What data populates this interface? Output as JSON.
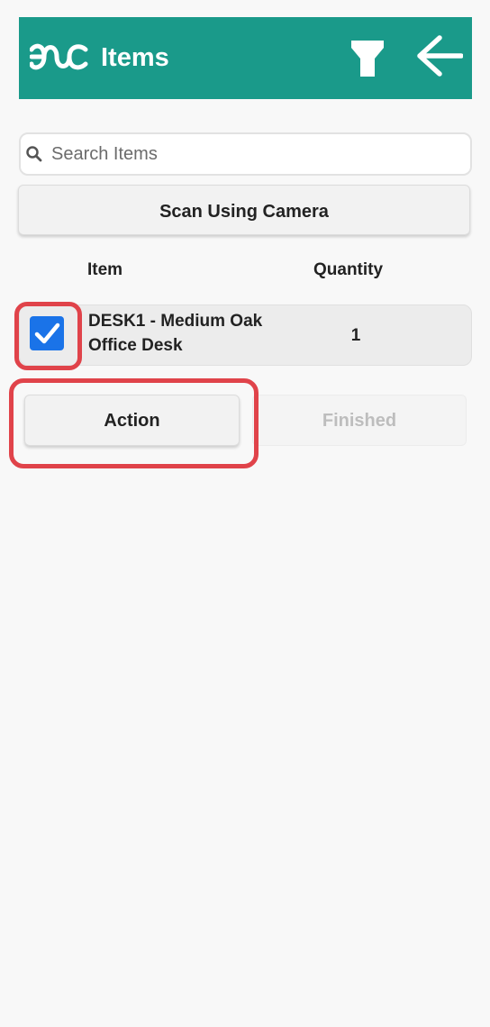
{
  "header": {
    "title": "Items",
    "background_color": "#1a9a8a",
    "logo_icon": "infinity-wave-logo-icon",
    "filter_icon": "filter-icon",
    "back_icon": "arrow-left-icon"
  },
  "search": {
    "placeholder": "Search Items",
    "value": "",
    "icon": "search-icon"
  },
  "scan_button": {
    "label": "Scan Using Camera"
  },
  "table": {
    "columns": [
      "Item",
      "Quantity"
    ],
    "rows": [
      {
        "item": "DESK1 - Medium Oak Office Desk",
        "quantity": "1",
        "checked": true
      }
    ]
  },
  "actions": {
    "action_label": "Action",
    "finished_label": "Finished",
    "finished_enabled": false
  },
  "colors": {
    "accent": "#1a9a8a",
    "checkbox": "#1a73e8",
    "highlight": "#e0434a",
    "disabled_text": "#bdbdbd"
  }
}
